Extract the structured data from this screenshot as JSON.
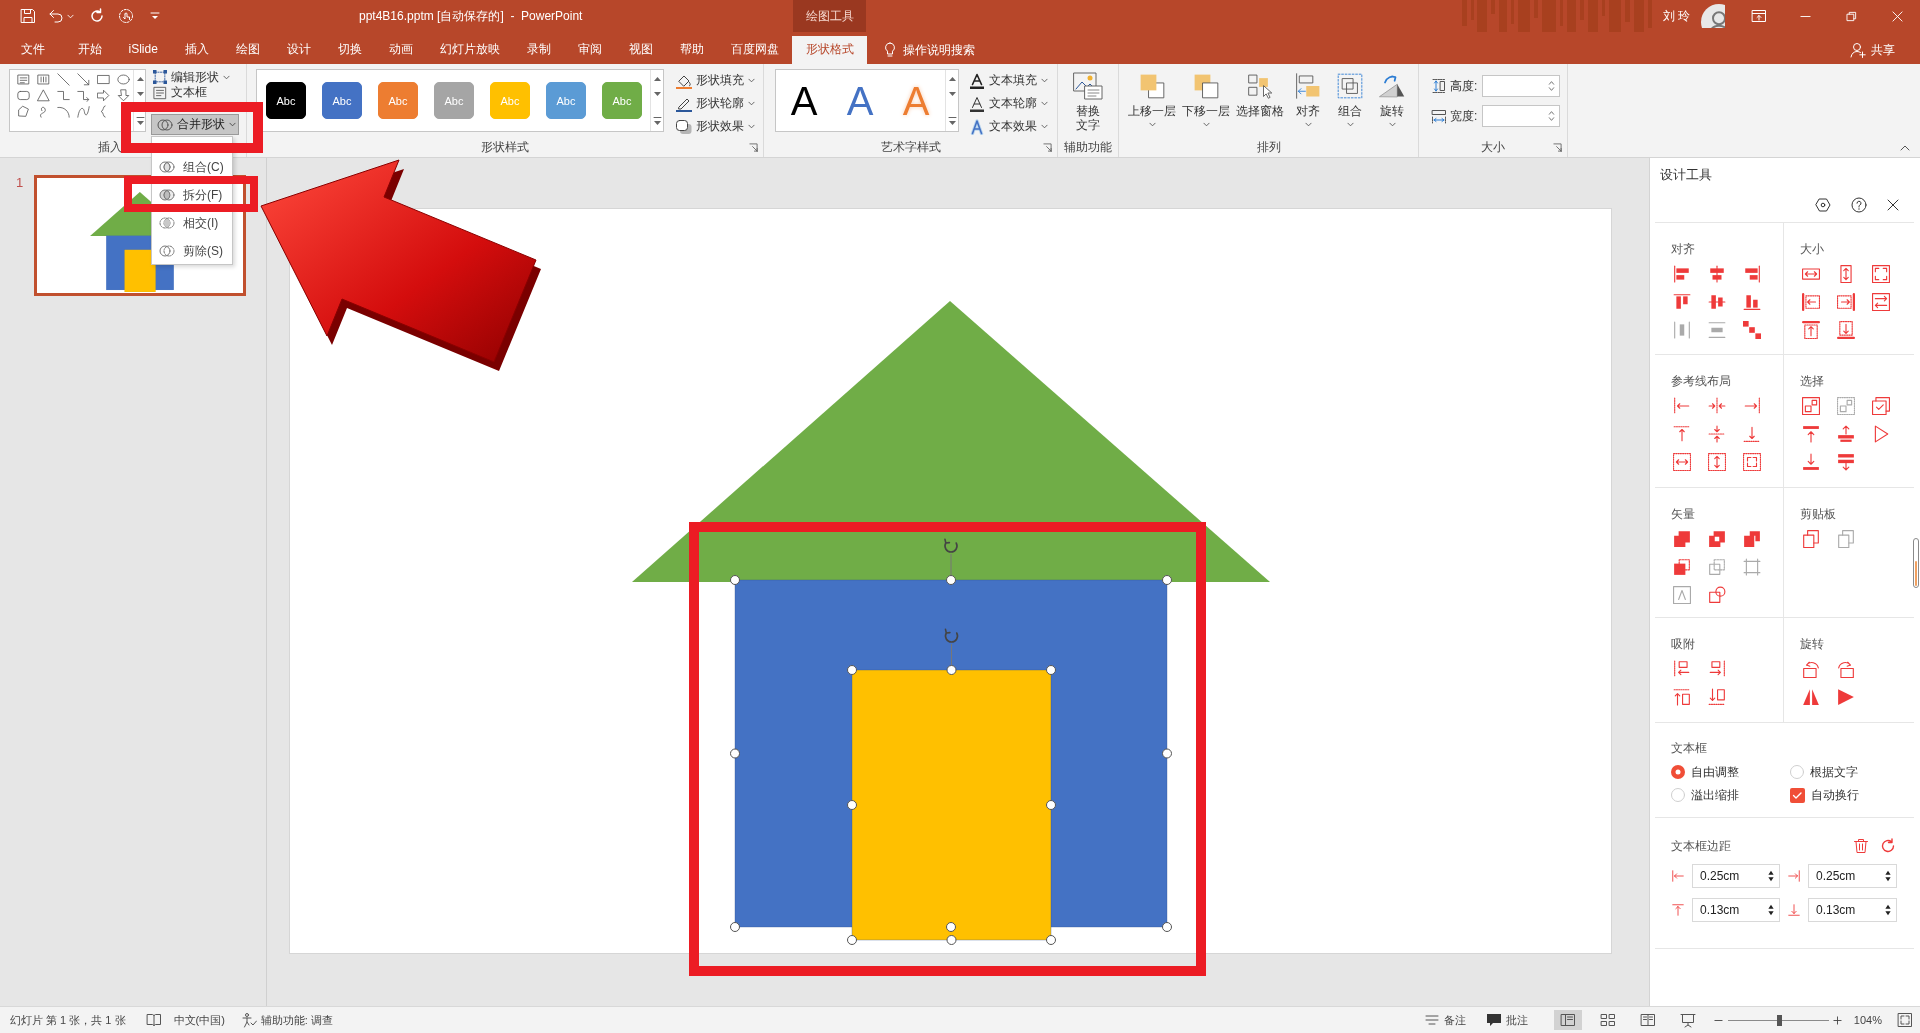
{
  "title_bar": {
    "title": "ppt4B16.pptm [自动保存的]  -  PowerPoint",
    "context_header": "绘图工具",
    "user": "刘 玲"
  },
  "tabs": [
    {
      "label": "文件",
      "selected": false
    },
    {
      "label": "开始",
      "selected": false
    },
    {
      "label": "iSlide",
      "selected": false
    },
    {
      "label": "插入",
      "selected": false
    },
    {
      "label": "绘图",
      "selected": false
    },
    {
      "label": "设计",
      "selected": false
    },
    {
      "label": "切换",
      "selected": false
    },
    {
      "label": "动画",
      "selected": false
    },
    {
      "label": "幻灯片放映",
      "selected": false
    },
    {
      "label": "录制",
      "selected": false
    },
    {
      "label": "审阅",
      "selected": false
    },
    {
      "label": "视图",
      "selected": false
    },
    {
      "label": "帮助",
      "selected": false
    },
    {
      "label": "百度网盘",
      "selected": false
    },
    {
      "label": "形状格式",
      "selected": true
    }
  ],
  "tell_me": "操作说明搜索",
  "share": "共享",
  "ribbon": {
    "insert_shapes": {
      "label": "插入",
      "commands": [
        {
          "label": "编辑形状",
          "dropdown": true
        },
        {
          "label": "文本框",
          "dropdown": false
        }
      ],
      "merge_shapes": {
        "label": "合并形状",
        "expanded": true
      }
    },
    "shape_styles": {
      "label": "形状样式",
      "presets": [
        {
          "text": "Abc",
          "color": "#000000"
        },
        {
          "text": "Abc",
          "color": "#4472c4"
        },
        {
          "text": "Abc",
          "color": "#ed7d31"
        },
        {
          "text": "Abc",
          "color": "#a5a5a5"
        },
        {
          "text": "Abc",
          "color": "#ffc000"
        },
        {
          "text": "Abc",
          "color": "#5b9bd5"
        },
        {
          "text": "Abc",
          "color": "#70ad47"
        }
      ],
      "commands": [
        {
          "label": "形状填充",
          "dropdown": true
        },
        {
          "label": "形状轮廓",
          "dropdown": true
        },
        {
          "label": "形状效果",
          "dropdown": true
        }
      ]
    },
    "wordart_styles": {
      "label": "艺术字样式",
      "presets": [
        {
          "text": "A",
          "kind": "solid",
          "color": "#000000"
        },
        {
          "text": "A",
          "kind": "solid",
          "color": "#4472c4"
        },
        {
          "text": "A",
          "kind": "outline",
          "color": "#ed7d31"
        }
      ],
      "commands": [
        {
          "label": "文本填充",
          "dropdown": true
        },
        {
          "label": "文本轮廓",
          "dropdown": true
        },
        {
          "label": "文本效果",
          "dropdown": true
        }
      ]
    },
    "accessibility": {
      "label": "辅助功能",
      "button": "替换文字"
    },
    "arrange": {
      "label": "排列",
      "buttons": [
        {
          "label": "上移一层",
          "dropdown": true
        },
        {
          "label": "下移一层",
          "dropdown": true
        },
        {
          "label": "选择窗格",
          "dropdown": false
        },
        {
          "label": "对齐",
          "dropdown": true
        },
        {
          "label": "组合",
          "dropdown": true
        },
        {
          "label": "旋转",
          "dropdown": true
        }
      ]
    },
    "size": {
      "label": "大小",
      "fields": [
        {
          "label": "高度:"
        },
        {
          "label": "宽度:"
        }
      ]
    }
  },
  "merge_menu": {
    "items": [
      {
        "label": "组合(C)"
      },
      {
        "label": "拆分(F)"
      },
      {
        "label": "相交(I)"
      },
      {
        "label": "剪除(S)"
      }
    ]
  },
  "slides_pane": {
    "slides": [
      {
        "number": "1",
        "selected": true
      }
    ]
  },
  "slide": {
    "shapes": [
      {
        "kind": "triangle",
        "color": "#70ad47",
        "selected": false
      },
      {
        "kind": "rectangle",
        "color": "#4472c4",
        "selected": true
      },
      {
        "kind": "rectangle",
        "color": "#ffc000",
        "selected": true
      }
    ]
  },
  "design_panel": {
    "title": "设计工具",
    "sections": [
      {
        "title": "对齐",
        "tools": [
          {
            "disabled": false
          },
          {
            "disabled": false
          },
          {
            "disabled": false
          },
          {
            "disabled": false
          },
          {
            "disabled": false
          },
          {
            "disabled": false
          },
          {
            "disabled": true
          },
          {
            "disabled": true
          },
          {
            "disabled": false
          }
        ]
      },
      {
        "title": "大小",
        "tools": [
          {
            "disabled": false
          },
          {
            "disabled": false
          },
          {
            "disabled": false
          },
          {
            "disabled": false
          },
          {
            "disabled": false
          },
          {
            "disabled": false
          },
          {
            "disabled": false
          },
          {
            "disabled": false
          }
        ]
      },
      {
        "title": "参考线布局",
        "tools": [
          {
            "disabled": false
          },
          {
            "disabled": false
          },
          {
            "disabled": false
          },
          {
            "disabled": false
          },
          {
            "disabled": false
          },
          {
            "disabled": false
          },
          {
            "disabled": false
          },
          {
            "disabled": false
          },
          {
            "disabled": false
          }
        ]
      },
      {
        "title": "选择",
        "tools": [
          {
            "disabled": false
          },
          {
            "disabled": true
          },
          {
            "disabled": false
          },
          {
            "disabled": false
          },
          {
            "disabled": false
          },
          {
            "disabled": false
          },
          {
            "disabled": false
          },
          {
            "disabled": false
          }
        ]
      },
      {
        "title": "矢量",
        "tools": [
          {
            "disabled": false
          },
          {
            "disabled": false
          },
          {
            "disabled": false
          },
          {
            "disabled": false
          },
          {
            "disabled": true
          },
          {
            "disabled": true
          },
          {
            "disabled": true
          },
          {
            "disabled": false
          }
        ]
      },
      {
        "title": "剪贴板",
        "tools": [
          {
            "disabled": false
          },
          {
            "disabled": true
          }
        ]
      },
      {
        "title": "吸附",
        "tools": [
          {
            "disabled": false
          },
          {
            "disabled": false
          },
          {
            "disabled": false
          },
          {
            "disabled": false
          }
        ]
      },
      {
        "title": "旋转",
        "tools": [
          {
            "disabled": false
          },
          {
            "disabled": false
          },
          {
            "disabled": false
          },
          {
            "disabled": false
          }
        ]
      }
    ],
    "textbox": {
      "title": "文本框",
      "options": [
        {
          "kind": "radio",
          "label": "自由调整",
          "selected": true
        },
        {
          "kind": "radio",
          "label": "根据文字",
          "selected": false
        },
        {
          "kind": "radio",
          "label": "溢出缩排",
          "selected": false
        },
        {
          "kind": "checkbox",
          "label": "自动换行",
          "checked": true
        }
      ]
    },
    "margins": {
      "title": "文本框边距",
      "fields": [
        {
          "value": "0.25cm"
        },
        {
          "value": "0.25cm"
        },
        {
          "value": "0.13cm"
        },
        {
          "value": "0.13cm"
        }
      ]
    }
  },
  "status_bar": {
    "slide_info": "幻灯片 第 1 张，共 1 张",
    "language": "中文(中国)",
    "accessibility": "辅助功能: 调查",
    "notes": "备注",
    "comments": "批注",
    "views": [
      {
        "selected": true
      },
      {
        "selected": false
      },
      {
        "selected": false
      },
      {
        "selected": false
      }
    ],
    "zoom": {
      "level": 0.51,
      "reading": "104%"
    }
  }
}
